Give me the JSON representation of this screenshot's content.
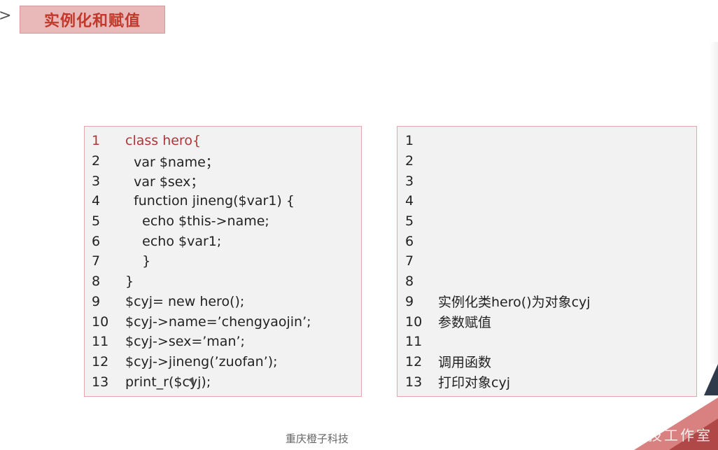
{
  "title": "实例化和赋值",
  "chevron_glyph": ">",
  "code_panel": {
    "lines": [
      {
        "num": "1",
        "code": "class hero{"
      },
      {
        "num": "2",
        "code": "  var $name；"
      },
      {
        "num": "3",
        "code": "  var $sex；"
      },
      {
        "num": "4",
        "code": "  function jineng($var1) {"
      },
      {
        "num": "5",
        "code": "    echo $this->name;"
      },
      {
        "num": "6",
        "code": "    echo $var1;"
      },
      {
        "num": "7",
        "code": "    }"
      },
      {
        "num": "8",
        "code": "}"
      },
      {
        "num": "9",
        "code": "$cyj= new hero();"
      },
      {
        "num": "10",
        "code": "$cyj->name=’chengyaojin’;"
      },
      {
        "num": "11",
        "code": "$cyj->sex=’man’;"
      },
      {
        "num": "12",
        "code": "$cyj->jineng(’zuofan’);"
      },
      {
        "num": "13",
        "code": "print_r($cyj);"
      }
    ],
    "highlight_color": "#b0363a"
  },
  "notes_panel": {
    "lines": [
      {
        "num": "1",
        "text": ""
      },
      {
        "num": "2",
        "text": ""
      },
      {
        "num": "3",
        "text": ""
      },
      {
        "num": "4",
        "text": ""
      },
      {
        "num": "5",
        "text": ""
      },
      {
        "num": "6",
        "text": ""
      },
      {
        "num": "7",
        "text": ""
      },
      {
        "num": "8",
        "text": ""
      },
      {
        "num": "9",
        "text": "实例化类hero()为对象cyj"
      },
      {
        "num": "10",
        "text": "参数赋值"
      },
      {
        "num": "11",
        "text": ""
      },
      {
        "num": "12",
        "text": "调用函数"
      },
      {
        "num": "13",
        "text": "打印对象cyj"
      }
    ]
  },
  "footer": "重庆橙子科技",
  "watermark": "橙子科技工作室"
}
